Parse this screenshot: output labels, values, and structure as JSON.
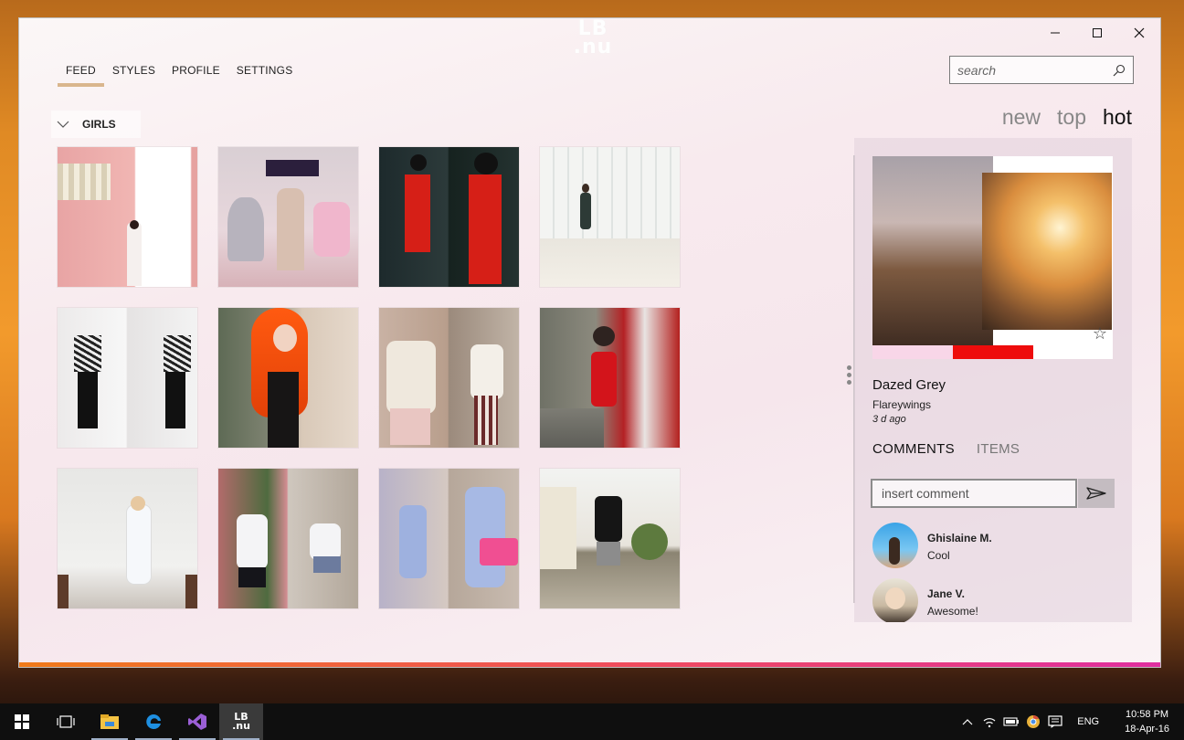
{
  "app": {
    "logo_line1": "LB",
    "logo_line2": ".nu"
  },
  "nav": [
    {
      "label": "FEED",
      "active": true
    },
    {
      "label": "STYLES"
    },
    {
      "label": "PROFILE"
    },
    {
      "label": "SETTINGS"
    }
  ],
  "search": {
    "placeholder": "search",
    "value": ""
  },
  "filter": {
    "label": "GIRLS"
  },
  "sort": [
    {
      "label": "new"
    },
    {
      "label": "top"
    },
    {
      "label": "hot",
      "active": true
    }
  ],
  "feed_tiles": [
    {
      "theme": "pink-wall"
    },
    {
      "theme": "storefront"
    },
    {
      "theme": "red-coat-duo"
    },
    {
      "theme": "white-corridor"
    },
    {
      "theme": "striped-top-duo"
    },
    {
      "theme": "orange-hair"
    },
    {
      "theme": "white-sweater-duo"
    },
    {
      "theme": "red-dress-train"
    },
    {
      "theme": "white-dress"
    },
    {
      "theme": "floral-duo"
    },
    {
      "theme": "blue-dress-duo"
    },
    {
      "theme": "black-tee-man"
    }
  ],
  "post": {
    "title": "Dazed Grey",
    "author": "Flareywings",
    "time": "3 d ago",
    "favorite_icon": "star-outline-icon"
  },
  "tabs": [
    {
      "label": "COMMENTS",
      "active": true
    },
    {
      "label": "ITEMS"
    }
  ],
  "comment_input": {
    "placeholder": "insert comment",
    "value": ""
  },
  "comments": [
    {
      "name": "Ghislaine M.",
      "text": "Cool"
    },
    {
      "name": "Jane V.",
      "text": "Awesome!"
    }
  ],
  "taskbar": {
    "apps": [
      "windows-start-icon",
      "task-view-icon",
      "file-explorer-icon",
      "edge-icon",
      "visual-studio-icon",
      "lbnu-app-icon"
    ],
    "tray_icons": [
      "chevron-up-icon",
      "wifi-icon",
      "battery-icon",
      "chrome-icon",
      "action-center-icon"
    ],
    "lang": "ENG",
    "time": "10:58 PM",
    "date": "18-Apr-16"
  },
  "colors": {
    "accent_underline": "#d9b68d",
    "feature_red": "#ee0c0c",
    "feature_pink": "#f8d6e8",
    "bottom_gradient_start": "#f07a1a",
    "bottom_gradient_end": "#e02fa0"
  }
}
